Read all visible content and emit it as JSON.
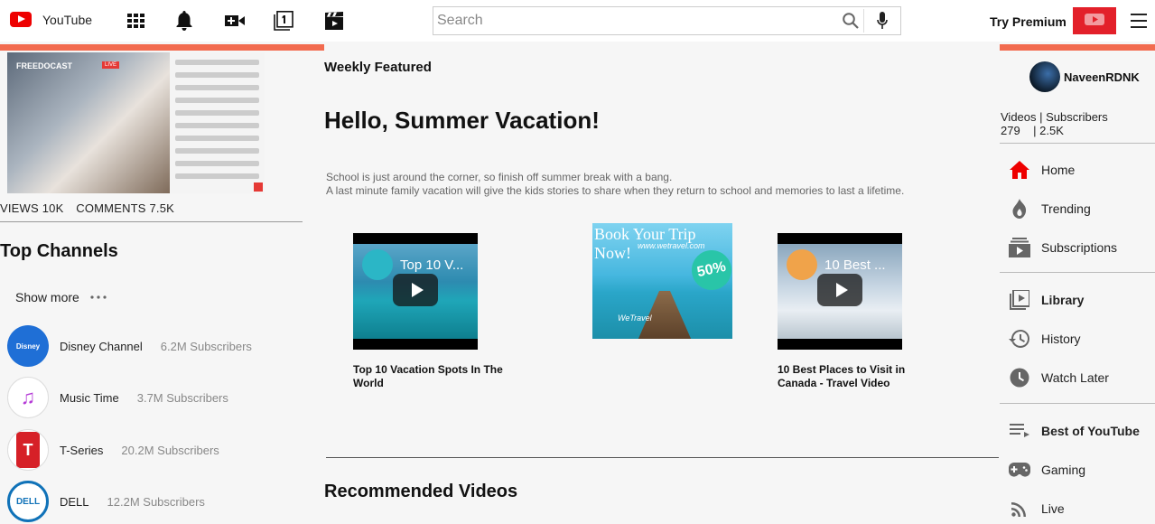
{
  "header": {
    "logo_text": "YouTube",
    "search_placeholder": "Search",
    "premium_label": "Try Premium",
    "premium_logo_text": "YouTube",
    "icons": [
      "apps-icon",
      "bell-icon",
      "video-camera-icon",
      "queue-icon",
      "clapperboard-icon"
    ]
  },
  "left": {
    "featured_thumb": {
      "brand": "FREEDOCAST",
      "live": "LIVE"
    },
    "views_label": "VIEWS 10K",
    "comments_label": "COMMENTS 7.5K",
    "top_channels_title": "Top Channels",
    "show_more_label": "Show more",
    "channels": [
      {
        "name": "Disney Channel",
        "subs": "6.2M Subscribers",
        "avatar_text": "Disney"
      },
      {
        "name": "Music Time",
        "subs": "3.7M Subscribers",
        "avatar_text": "♫"
      },
      {
        "name": "T-Series",
        "subs": "20.2M Subscribers",
        "avatar_text": "T"
      },
      {
        "name": "DELL",
        "subs": "12.2M Subscribers",
        "avatar_text": "DELL"
      }
    ]
  },
  "center": {
    "weekly_label": "Weekly Featured",
    "hero_title": "Hello, Summer Vacation!",
    "hero_desc_line1": "School is just around the corner, so finish off summer break with a bang.",
    "hero_desc_line2": "A last minute family vacation will give the kids stories to share when they return to school and memories to last a lifetime.",
    "videos": [
      {
        "thumb_title": "Top 10 V...",
        "caption": "Top 10 Vacation Spots In The World"
      },
      {
        "thumb_title": "10 Best ...",
        "caption": "10 Best Places to Visit in Canada - Travel Video"
      }
    ],
    "ad": {
      "headline": "Book Your Trip Now!",
      "url": "www.wetravel.com",
      "deal": "50%",
      "small": "WeTravel"
    },
    "recommended_title": "Recommended Videos"
  },
  "right": {
    "username": "NaveenRDNK",
    "stats_line1": "Videos | Subscribers",
    "stats_line2": "279    | 2.5K",
    "nav": [
      {
        "label": "Home",
        "icon": "home-icon"
      },
      {
        "label": "Trending",
        "icon": "flame-icon"
      },
      {
        "label": "Subscriptions",
        "icon": "subscriptions-icon"
      },
      {
        "label": "Library",
        "icon": "library-icon"
      },
      {
        "label": "History",
        "icon": "history-icon"
      },
      {
        "label": "Watch Later",
        "icon": "clock-icon"
      },
      {
        "label": "Best of YouTube",
        "icon": "list-icon"
      },
      {
        "label": "Gaming",
        "icon": "gamepad-icon"
      },
      {
        "label": "Live",
        "icon": "live-icon"
      }
    ]
  },
  "colors": {
    "accent": "#f26b4f",
    "brand_red": "#e00000",
    "home_red": "#e00000"
  }
}
